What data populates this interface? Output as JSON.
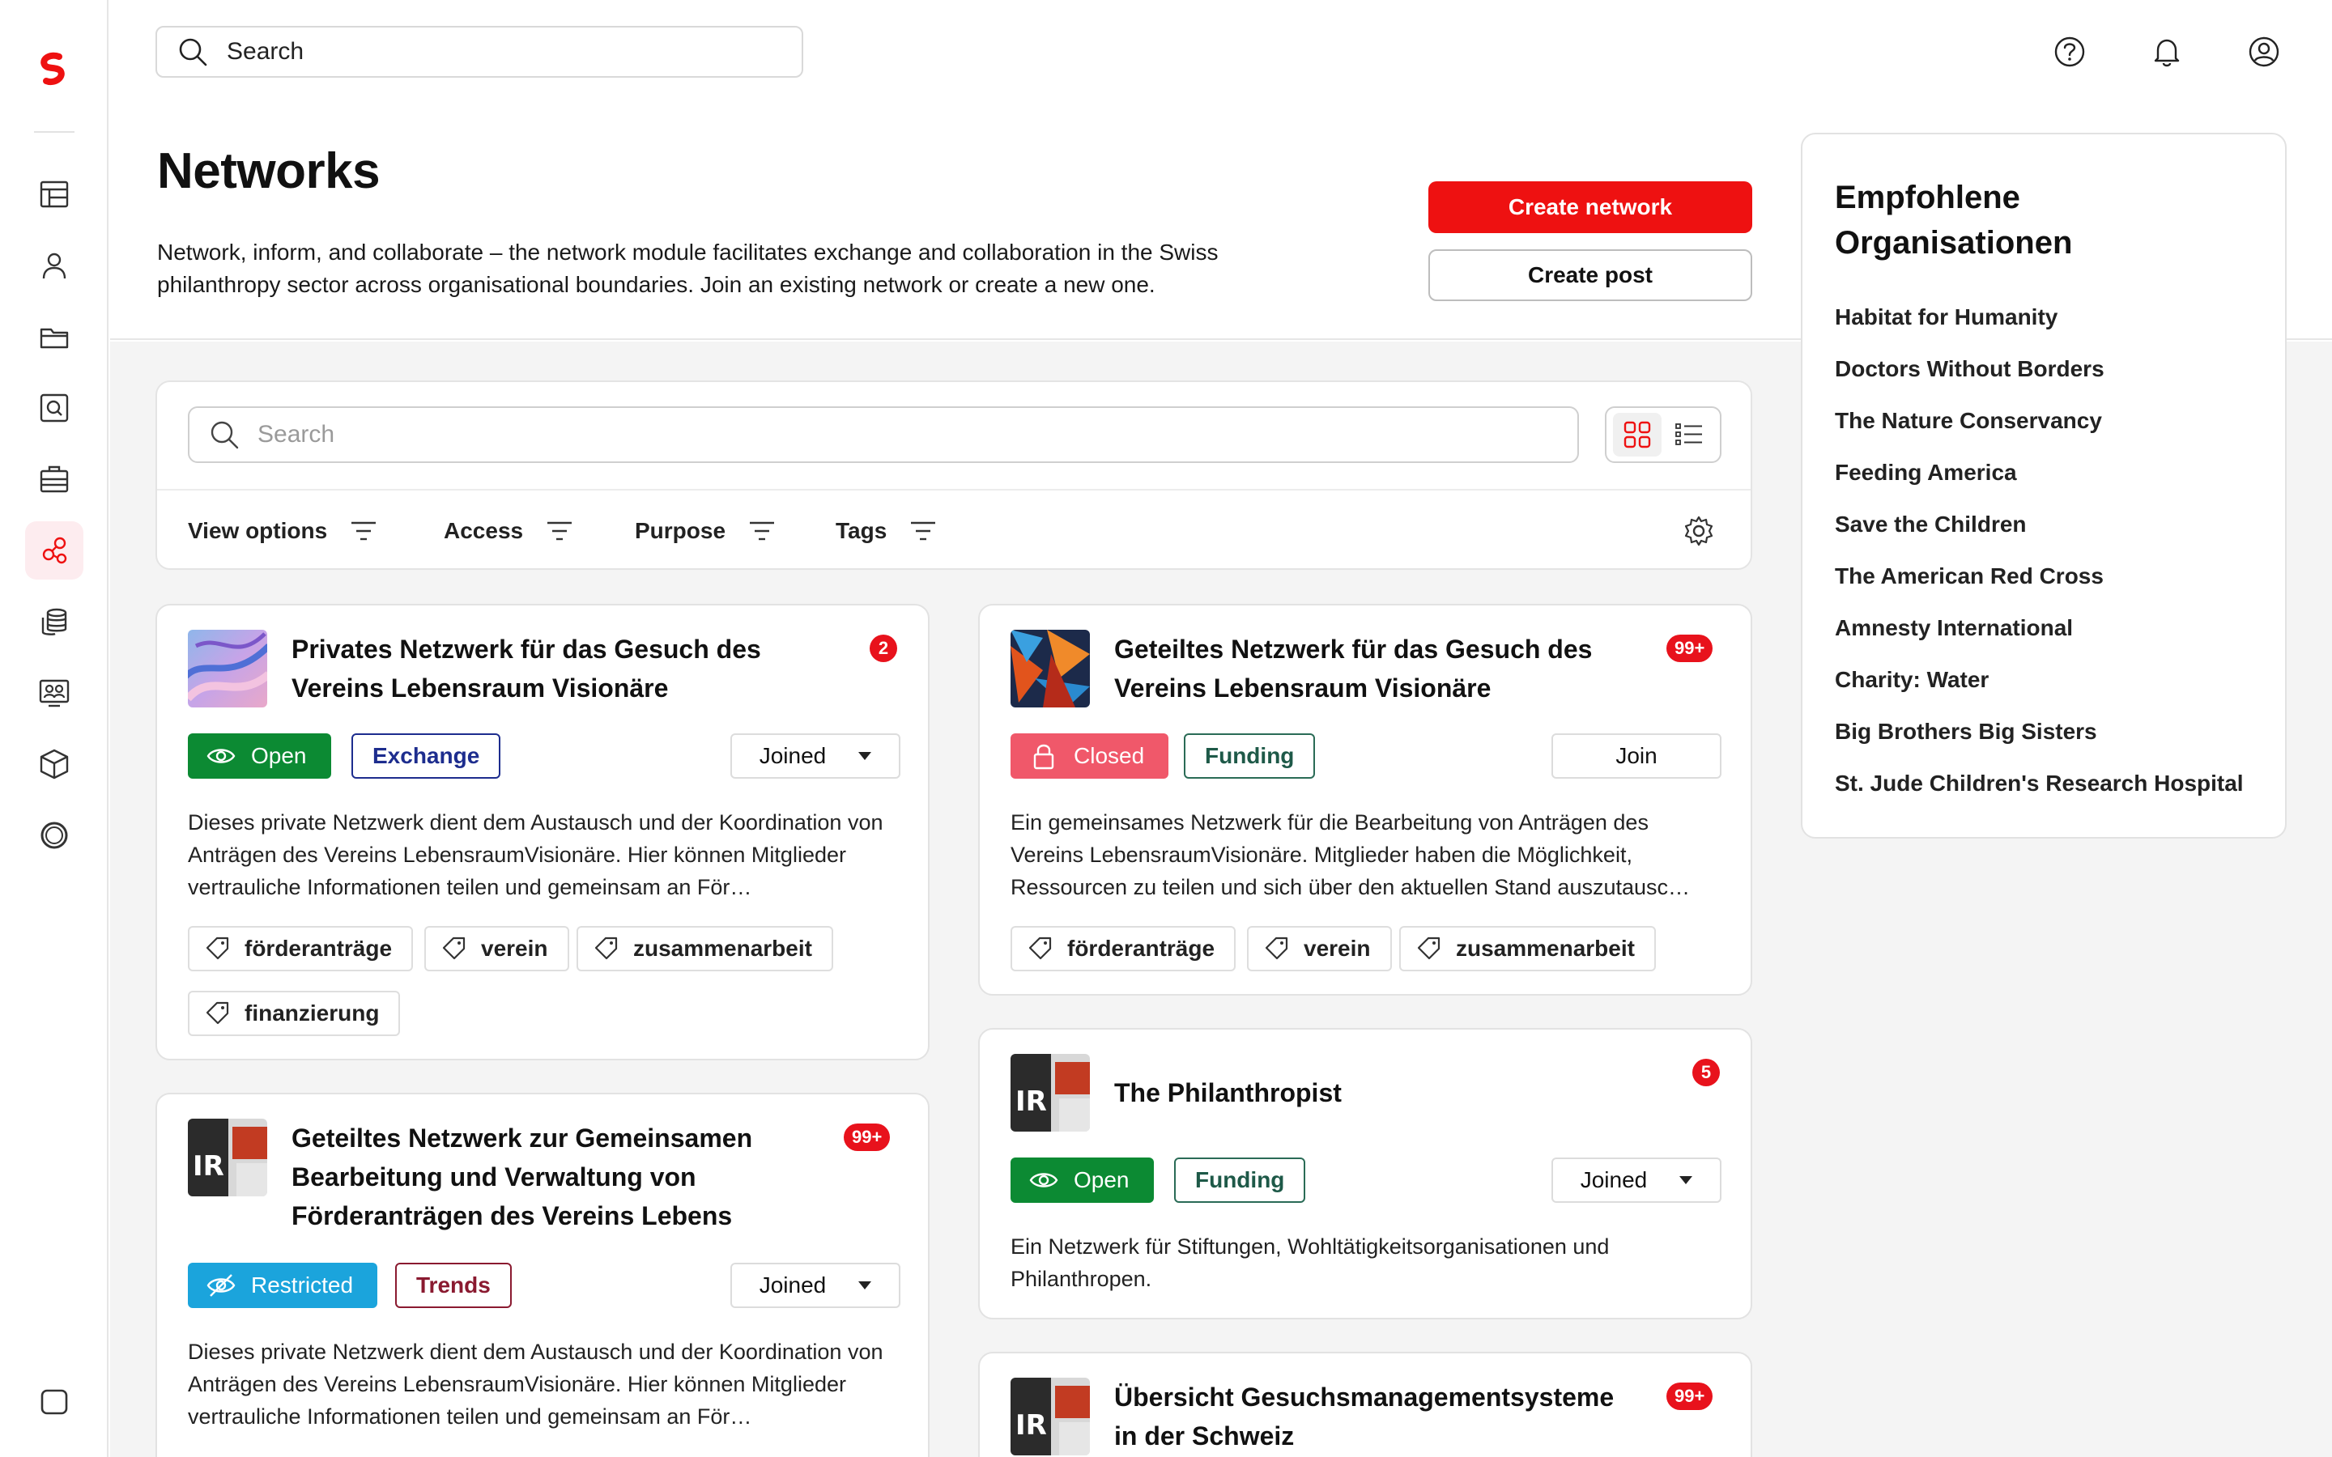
{
  "top_search": {
    "placeholder": "Search"
  },
  "header": {
    "title": "Networks",
    "description": "Network, inform, and collaborate – the network module facilitates exchange and collaboration in the Swiss philanthropy sector across organisational boundaries. Join an existing network or create a new one.",
    "create_network_label": "Create network",
    "create_post_label": "Create post"
  },
  "filters": {
    "search_placeholder": "Search",
    "items": [
      "View options",
      "Access",
      "Purpose",
      "Tags"
    ]
  },
  "cards": [
    {
      "title": "Privates Netzwerk für das Gesuch des Vereins Lebensraum Visionäre",
      "badge_count": "2",
      "access": "Open",
      "purpose": "Exchange",
      "membership": "Joined",
      "description": "Dieses private Netzwerk dient dem Austausch und der Koordination von Anträgen des Vereins LebensraumVisionäre. Hier können Mitglieder vertrauliche Informationen teilen und gemeinsam an För…",
      "tags": [
        "förderanträge",
        "verein",
        "zusammenarbeit",
        "finanzierung"
      ]
    },
    {
      "title": "Geteiltes Netzwerk für das Gesuch des Vereins Lebensraum Visionäre",
      "badge_count": "99+",
      "access": "Closed",
      "purpose": "Funding",
      "membership": "Join",
      "description": "Ein gemeinsames Netzwerk für die Bearbeitung von Anträgen des Vereins LebensraumVisionäre. Mitglieder haben die Möglichkeit, Ressourcen zu teilen und sich über den aktuellen Stand auszutausc…",
      "tags": [
        "förderanträge",
        "verein",
        "zusammenarbeit"
      ]
    },
    {
      "title": "Geteiltes Netzwerk zur Gemeinsamen Bearbeitung und Verwaltung von Förderanträgen des Vereins Lebens",
      "badge_count": "99+",
      "access": "Restricted",
      "purpose": "Trends",
      "membership": "Joined",
      "description": "Dieses private Netzwerk dient dem Austausch und der Koordination von Anträgen des Vereins LebensraumVisionäre. Hier können Mitglieder vertrauliche Informationen teilen und gemeinsam an För…"
    },
    {
      "title": "The Philanthropist",
      "badge_count": "5",
      "access": "Open",
      "purpose": "Funding",
      "membership": "Joined",
      "description": "Ein Netzwerk für Stiftungen, Wohltätigkeitsorganisationen und Philanthropen."
    },
    {
      "title": "Übersicht Gesuchsmanagementsysteme in der Schweiz",
      "badge_count": "99+"
    }
  ],
  "orgs": {
    "title": "Empfohlene Organisationen",
    "items": [
      "Habitat for Humanity",
      "Doctors Without Borders",
      "The Nature Conservancy",
      "Feeding America",
      "Save the Children",
      "The American Red Cross",
      "Amnesty International",
      "Charity: Water",
      "Big Brothers Big Sisters",
      "St. Jude Children's Research Hospital"
    ]
  },
  "colors": {
    "brand_red": "#ee1111",
    "open_green": "#0c8a33",
    "closed_pink": "#f0586a",
    "restricted_blue": "#1ba4dc"
  }
}
